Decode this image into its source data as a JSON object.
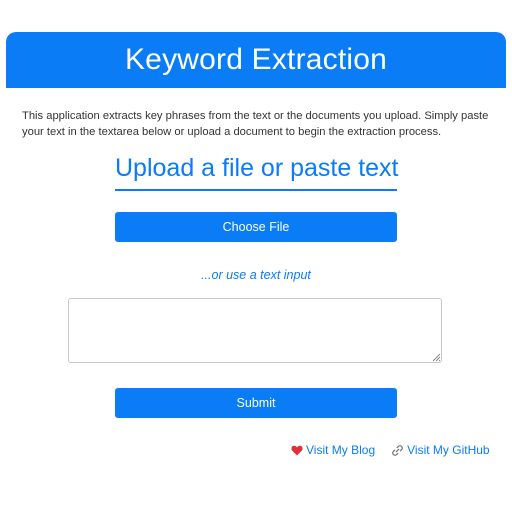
{
  "header": {
    "title": "Keyword Extraction",
    "background_color": "#0a7cf5"
  },
  "intro": {
    "text": "This application extracts key phrases from the text or the documents you upload. Simply paste your text in the textarea below or upload a document to begin the extraction process."
  },
  "upload": {
    "heading": "Upload a file or paste text",
    "choose_file_label": "Choose File",
    "or_text": "...or use a text input"
  },
  "text_input": {
    "value": "",
    "placeholder": ""
  },
  "form": {
    "submit_label": "Submit"
  },
  "links": [
    {
      "label": "Visit My Blog",
      "icon": "heart-icon"
    },
    {
      "label": "Visit My GitHub",
      "icon": "link-icon"
    }
  ],
  "colors": {
    "accent": "#0a7cf5",
    "heart": "#e0303a"
  }
}
